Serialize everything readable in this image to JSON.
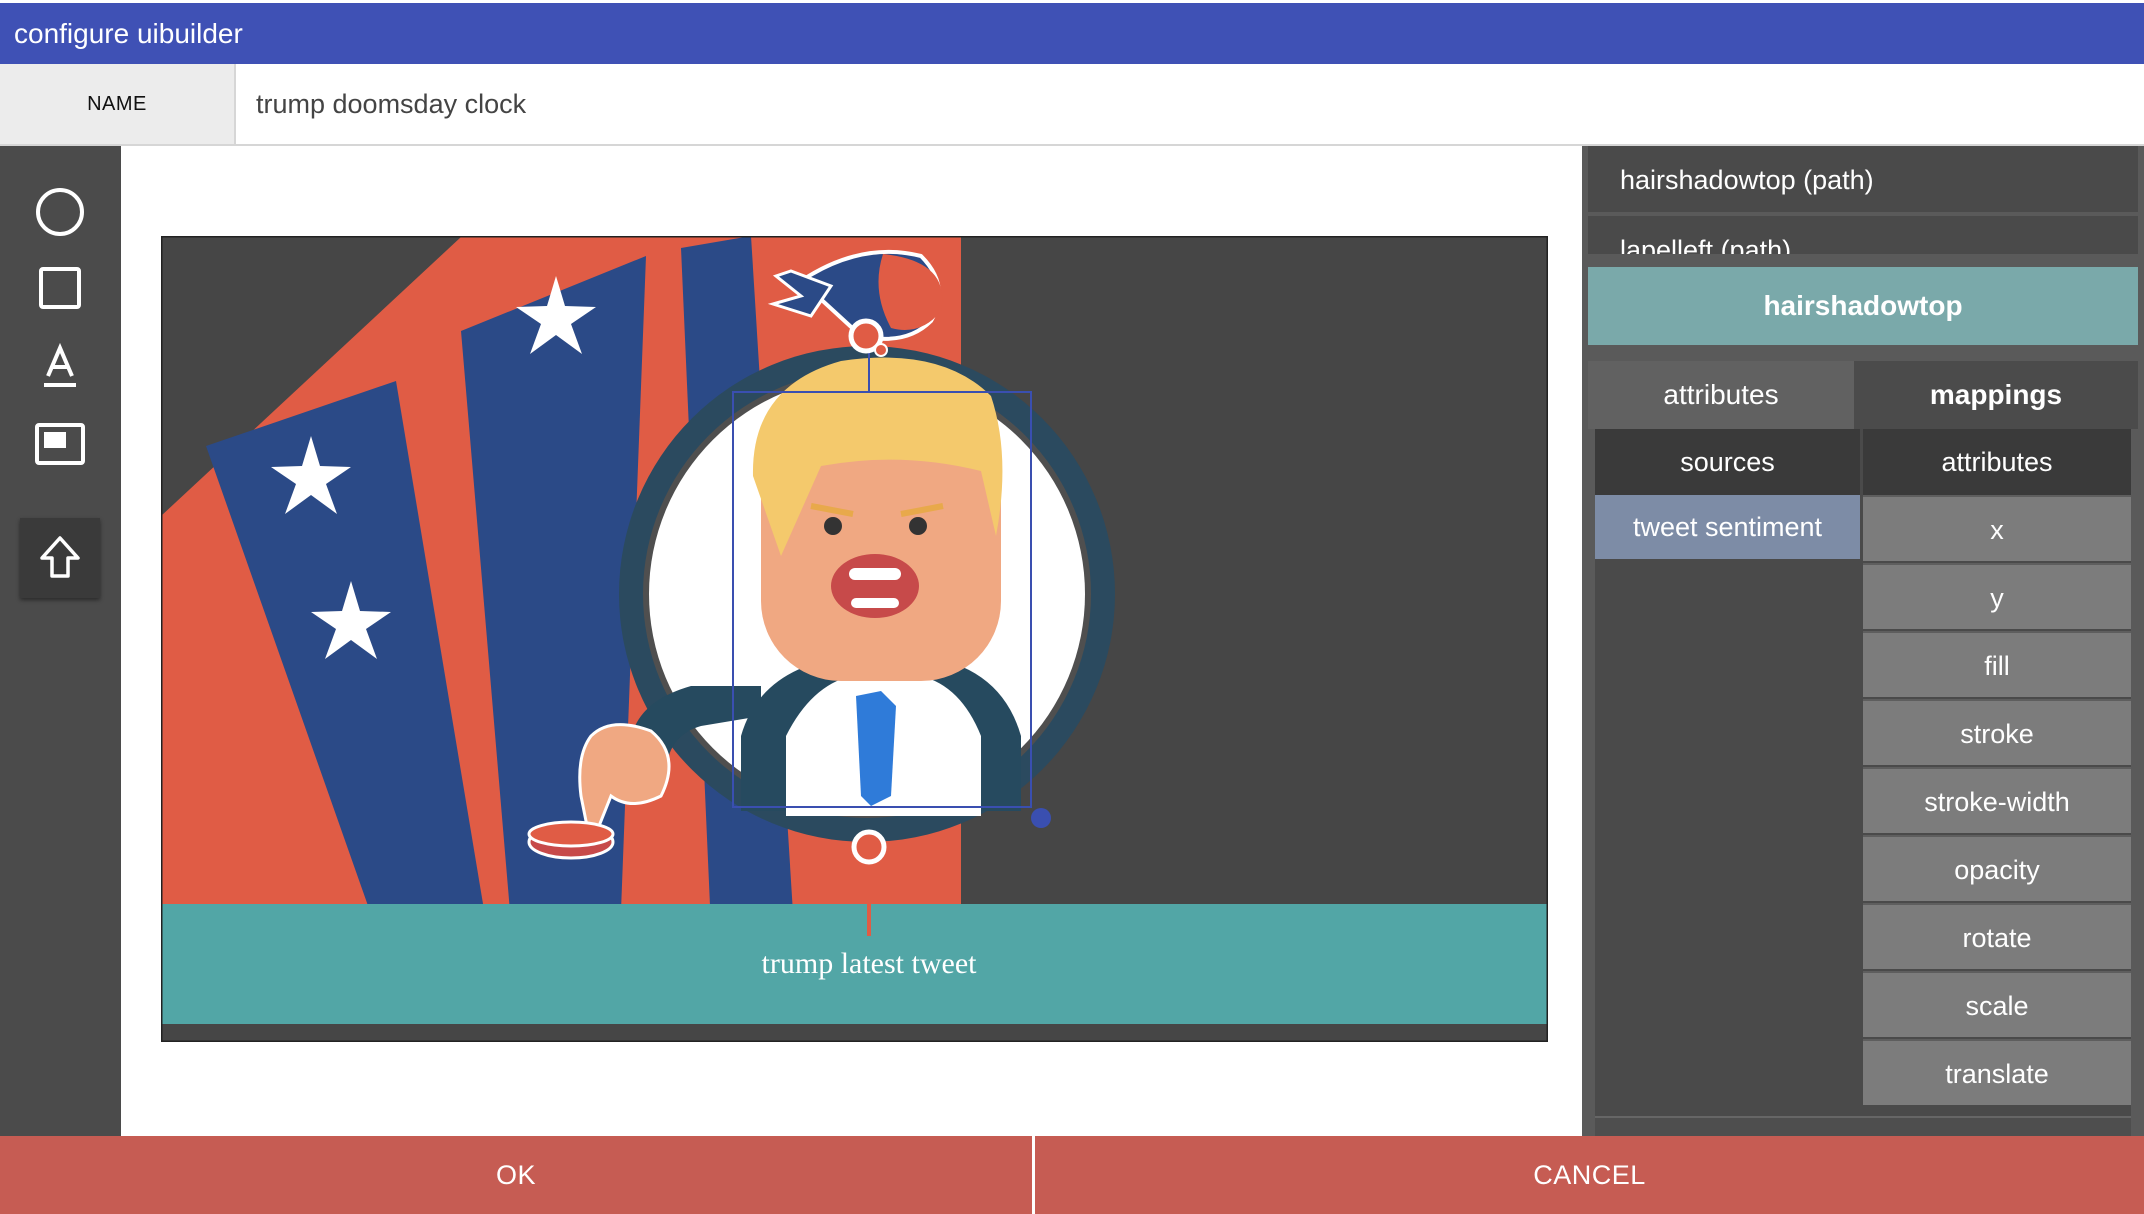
{
  "window": {
    "title": "configure uibuilder"
  },
  "name_field": {
    "label": "NAME",
    "value": "trump doomsday clock"
  },
  "toolbar": {
    "tools": [
      {
        "icon": "circle-icon"
      },
      {
        "icon": "square-icon"
      },
      {
        "icon": "text-icon"
      },
      {
        "icon": "image-icon"
      },
      {
        "icon": "upload-icon"
      }
    ]
  },
  "canvas": {
    "caption": "trump latest tweet",
    "colors": {
      "background": "#464646",
      "banner": "#52a6a6",
      "red": "#e05c45",
      "blue": "#2b4a87",
      "handle": "#3a4fb0"
    }
  },
  "layers": {
    "items": [
      "hairshadowtop (path)",
      "lapelleft (path)"
    ],
    "selected": "hairshadowtop"
  },
  "panel": {
    "tabs": [
      "attributes",
      "mappings"
    ],
    "active_tab": "mappings",
    "sources_header": "sources",
    "attributes_header": "attributes",
    "sources": [
      "tweet sentiment"
    ],
    "attributes": [
      "x",
      "y",
      "fill",
      "stroke",
      "stroke-width",
      "opacity",
      "rotate",
      "scale",
      "translate"
    ]
  },
  "buttons": {
    "ok": "OK",
    "cancel": "CANCEL"
  }
}
